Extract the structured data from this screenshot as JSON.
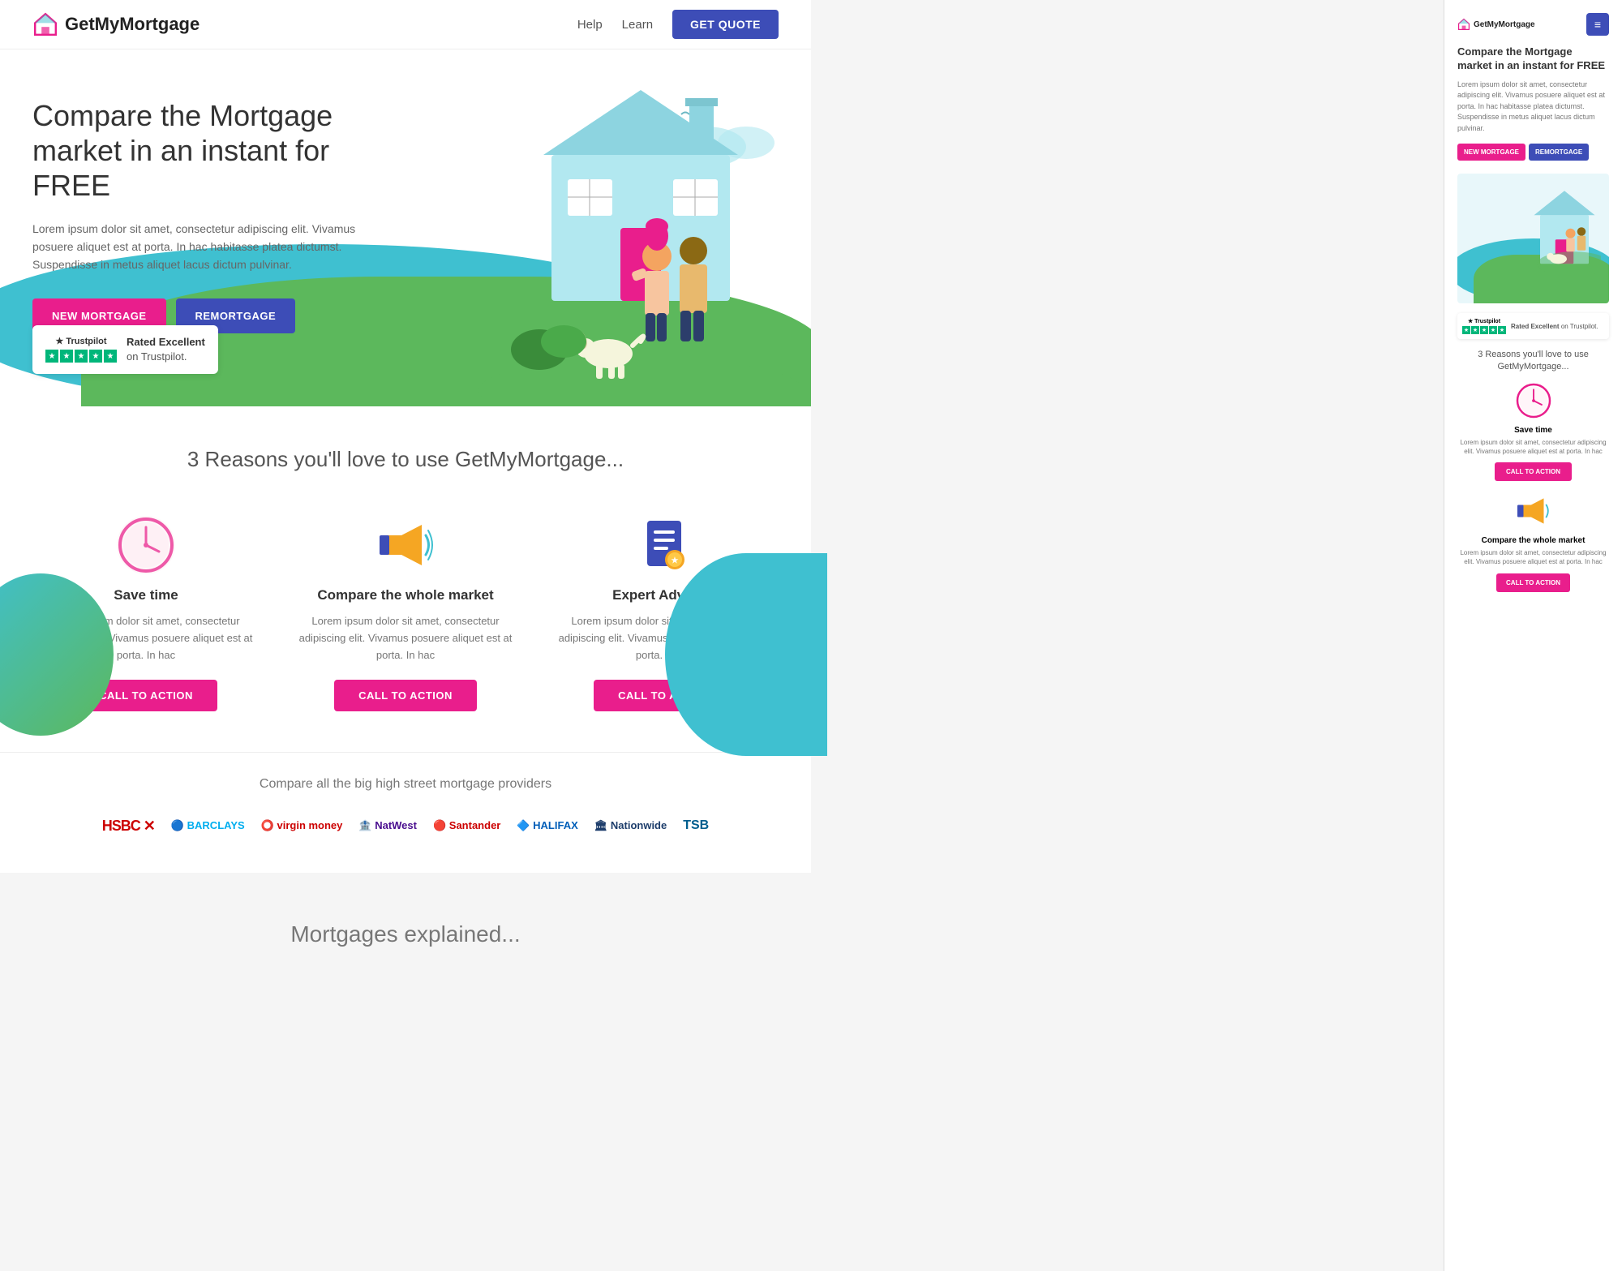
{
  "site": {
    "name": "GetMyMortgage",
    "logoAlt": "GetMyMortgage logo"
  },
  "navbar": {
    "help_label": "Help",
    "learn_label": "Learn",
    "get_quote_label": "GET QUOTE"
  },
  "hero": {
    "title": "Compare the Mortgage market in an instant for FREE",
    "description": "Lorem ipsum dolor sit amet, consectetur adipiscing elit. Vivamus posuere aliquet est at porta. In hac habitasse platea dictumst. Suspendisse in metus aliquet lacus dictum pulvinar.",
    "btn_new_mortgage": "NEW MORTGAGE",
    "btn_remortgage": "REMORTGAGE"
  },
  "trustpilot": {
    "rated_label": "Rated Excellent",
    "on_label": "on Trustpilot."
  },
  "reasons": {
    "title": "3 Reasons you'll love to use GetMyMortgage...",
    "items": [
      {
        "icon": "clock",
        "title": "Save time",
        "desc": "Lorem ipsum dolor sit amet, consectetur adipiscing elit. Vivamus posuere aliquet est at porta. In hac",
        "cta": "CALL TO ACTION"
      },
      {
        "icon": "megaphone",
        "title": "Compare the whole market",
        "desc": "Lorem ipsum dolor sit amet, consectetur adipiscing elit. Vivamus posuere aliquet est at porta. In hac",
        "cta": "CALL TO ACTION"
      },
      {
        "icon": "document",
        "title": "Expert Advisors",
        "desc": "Lorem ipsum dolor sit amet, consectetur adipiscing elit. Vivamus posuere aliquet est at porta. In hac",
        "cta": "CALL TO ACTION"
      }
    ]
  },
  "providers": {
    "title": "Compare all the big high street mortgage providers",
    "logos": [
      "HSBC",
      "BARCLAYS",
      "virgin money",
      "NatWest",
      "Santander",
      "HALIFAX",
      "Nationwide",
      "TSB"
    ]
  },
  "mortgages_section": {
    "title": "Mortgages explained..."
  },
  "right_panel": {
    "hero_title": "Compare the Mortgage market in an instant for FREE",
    "hero_desc": "Lorem ipsum dolor sit amet, consectetur adipiscing elit. Vivamus posuere aliquet est at porta. In hac habitasse platea dictumst. Suspendisse in metus aliquet lacus dictum pulvinar.",
    "reasons_title": "3 Reasons you'll love to use GetMyMortgage...",
    "reason1_title": "Save time",
    "reason1_desc": "Lorem ipsum dolor sit amet, consectetur adipiscing elit. Vivamus posuere aliquet est at porta. In hac",
    "reason1_cta": "CALL TO ACTION",
    "reason2_title": "Compare the whole market",
    "reason2_desc": "Lorem ipsum dolor sit amet, consectetur adipiscing elit. Vivamus posuere aliquet est at porta. In hac",
    "reason2_cta": "CALL TO ACTION",
    "btn_new_mortgage": "NEW MORTGAGE",
    "btn_remortgage": "REMORTGAGE",
    "rated_label": "Rated Excellent",
    "on_label": "on Trustpilot."
  }
}
